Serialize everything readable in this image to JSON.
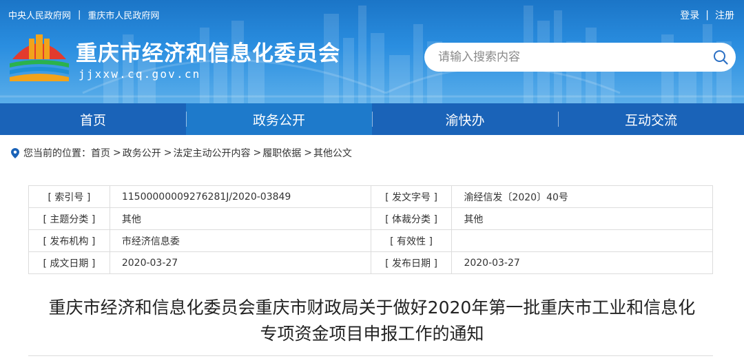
{
  "header": {
    "top_links": [
      "中央人民政府网",
      "重庆市人民政府网"
    ],
    "top_sep": "|",
    "user_links": {
      "login": "登录",
      "sep": "|",
      "register": "注册"
    },
    "site_title": "重庆市经济和信息化委员会",
    "site_domain": "jjxxw.cq.gov.cn",
    "search_placeholder": "请输入搜索内容",
    "search_icon": "search-icon"
  },
  "nav": {
    "items": [
      "首页",
      "政务公开",
      "渝快办",
      "互动交流"
    ],
    "active": "政务公开"
  },
  "breadcrumb": {
    "prefix": "您当前的位置：",
    "items": [
      "首页",
      "政务公开",
      "法定主动公开内容",
      "履职依据",
      "其他公文"
    ],
    "sep": ">"
  },
  "info_table": {
    "rows": [
      {
        "l1": "[ 索引号 ]",
        "v1": "11500000009276281J/2020-03849",
        "l2": "[ 发文字号 ]",
        "v2": "渝经信发〔2020〕40号"
      },
      {
        "l1": "[ 主题分类 ]",
        "v1": "其他",
        "l2": "[ 体裁分类 ]",
        "v2": "其他"
      },
      {
        "l1": "[ 发布机构 ]",
        "v1": "市经济信息委",
        "l2": "[ 有效性 ]",
        "v2": ""
      },
      {
        "l1": "[ 成文日期 ]",
        "v1": "2020-03-27",
        "l2": "[ 发布日期 ]",
        "v2": "2020-03-27"
      }
    ]
  },
  "document": {
    "title_line1": "重庆市经济和信息化委员会重庆市财政局关于做好2020年第一批重庆市工业和信息化",
    "title_line2": "专项资金项目申报工作的通知"
  },
  "colors": {
    "header_blue": "#2a8ee0",
    "nav_blue": "#1a63b8",
    "nav_active": "#1e7acb",
    "logo_red": "#e23b2e",
    "logo_orange": "#f2a31b",
    "logo_green": "#2bb24c"
  }
}
